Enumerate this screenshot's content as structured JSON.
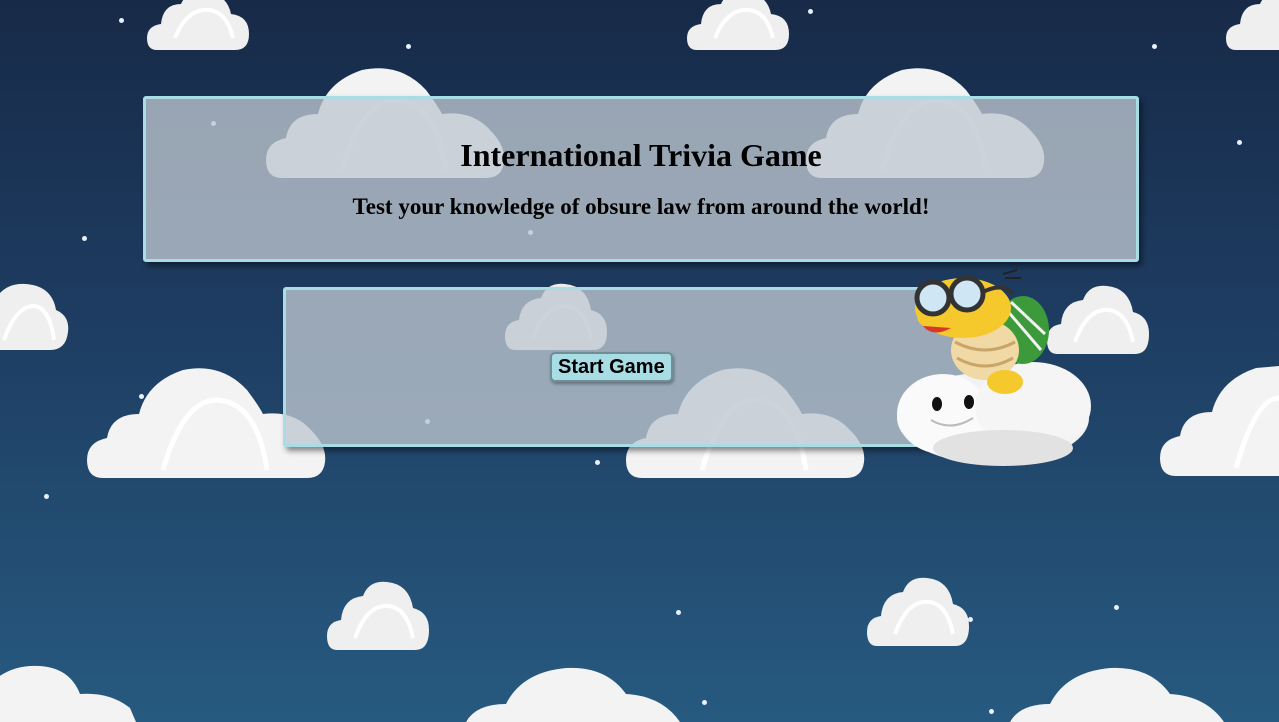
{
  "header": {
    "title": "International Trivia Game",
    "subtitle": "Test your knowledge of obsure law from around the world!"
  },
  "game": {
    "start_label": "Start Game"
  },
  "colors": {
    "sky_top": "#172a48",
    "sky_bottom": "#275a80",
    "panel_border": "#a9dde6",
    "button_bg": "#a9dde6"
  },
  "icons": [
    "cloud-icon",
    "star-icon",
    "lakitu-mascot-icon"
  ]
}
